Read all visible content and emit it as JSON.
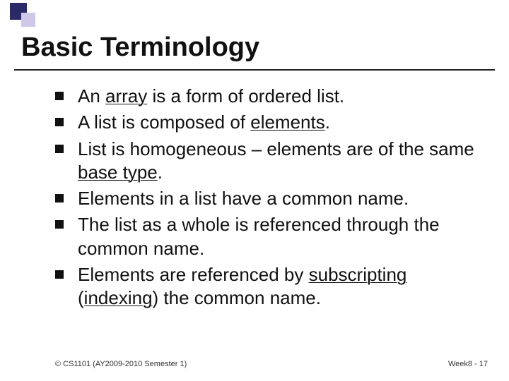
{
  "slide": {
    "title": "Basic Terminology",
    "bullets": [
      {
        "pre": "An ",
        "u1": "array",
        "mid": " is a form of ordered list.",
        "u2": "",
        "post": ""
      },
      {
        "pre": "A list is composed of ",
        "u1": "elements",
        "mid": ".",
        "u2": "",
        "post": ""
      },
      {
        "pre": "List is homogeneous – elements are of the same ",
        "u1": "base type",
        "mid": ".",
        "u2": "",
        "post": ""
      },
      {
        "pre": "Elements in a list have a common name.",
        "u1": "",
        "mid": "",
        "u2": "",
        "post": ""
      },
      {
        "pre": "The list as a whole is referenced through the common name.",
        "u1": "",
        "mid": "",
        "u2": "",
        "post": ""
      },
      {
        "pre": "Elements are referenced by ",
        "u1": "subscripting",
        "mid": " (",
        "u2": "indexing",
        "post": ") the common name."
      }
    ],
    "footer_left": "© CS1101 (AY2009-2010 Semester 1)",
    "footer_right": "Week8 - 17"
  }
}
